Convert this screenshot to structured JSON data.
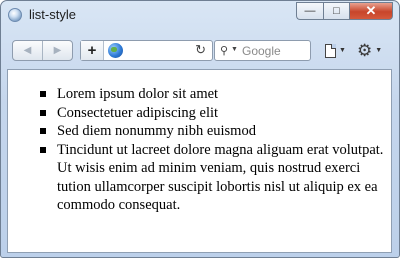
{
  "window": {
    "title": "list-style"
  },
  "toolbar": {
    "search_placeholder": "Google",
    "icons": {
      "back": "back-arrow-icon",
      "forward": "forward-arrow-icon",
      "add": "plus-icon",
      "site": "globe-icon",
      "reload": "reload-icon",
      "search": "magnifier-icon",
      "page": "page-icon",
      "settings": "gear-icon"
    }
  },
  "content": {
    "list_style": "square",
    "items": [
      "Lorem ipsum dolor sit amet",
      "Consectetuer adipiscing elit",
      "Sed diem nonummy nibh euismod",
      "Tincidunt ut lacreet dolore magna aliguam erat volutpat. Ut wisis enim ad minim veniam, quis nostrud exerci tution ullamcorper suscipit lobortis nisl ut aliquip ex ea commodo consequat."
    ]
  },
  "colors": {
    "chrome": "#c5d6ec",
    "close_button": "#c8452a",
    "page_background": "#ffffff"
  }
}
